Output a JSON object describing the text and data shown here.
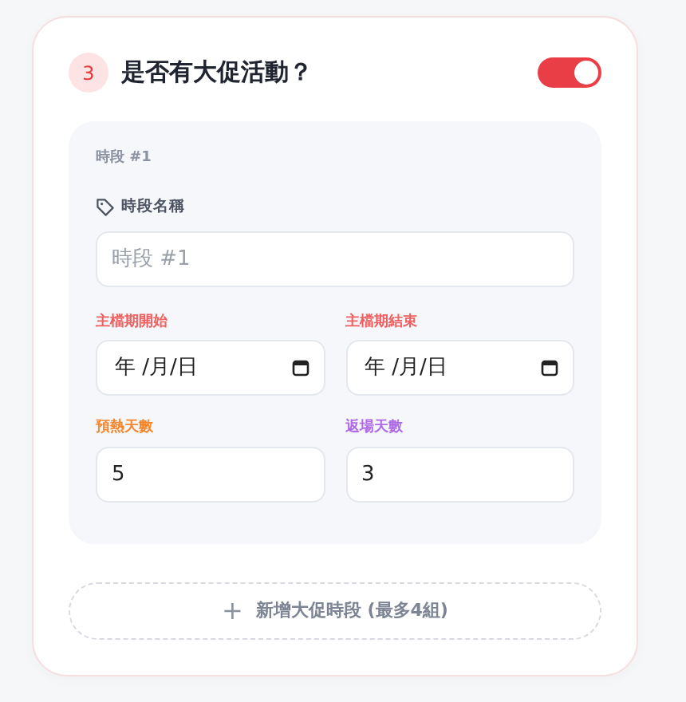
{
  "section": {
    "number": "3",
    "title": "是否有大促活動？",
    "enabled": true
  },
  "periods": [
    {
      "heading": "時段 #1",
      "name_label": "時段名稱",
      "name_placeholder": "時段 #1",
      "fields": [
        {
          "label": "主檔期開始",
          "kind": "date",
          "color": "#f06060",
          "value": "年 /月/日"
        },
        {
          "label": "主檔期結束",
          "kind": "date",
          "color": "#f06060",
          "value": "年 /月/日"
        },
        {
          "label": "預熱天數",
          "kind": "number",
          "color": "#f5862e",
          "value": "5"
        },
        {
          "label": "返場天數",
          "kind": "number",
          "color": "#b069e8",
          "value": "3"
        }
      ]
    }
  ],
  "add_button": {
    "icon": "+",
    "label": "新增大促時段 (最多4組)"
  }
}
